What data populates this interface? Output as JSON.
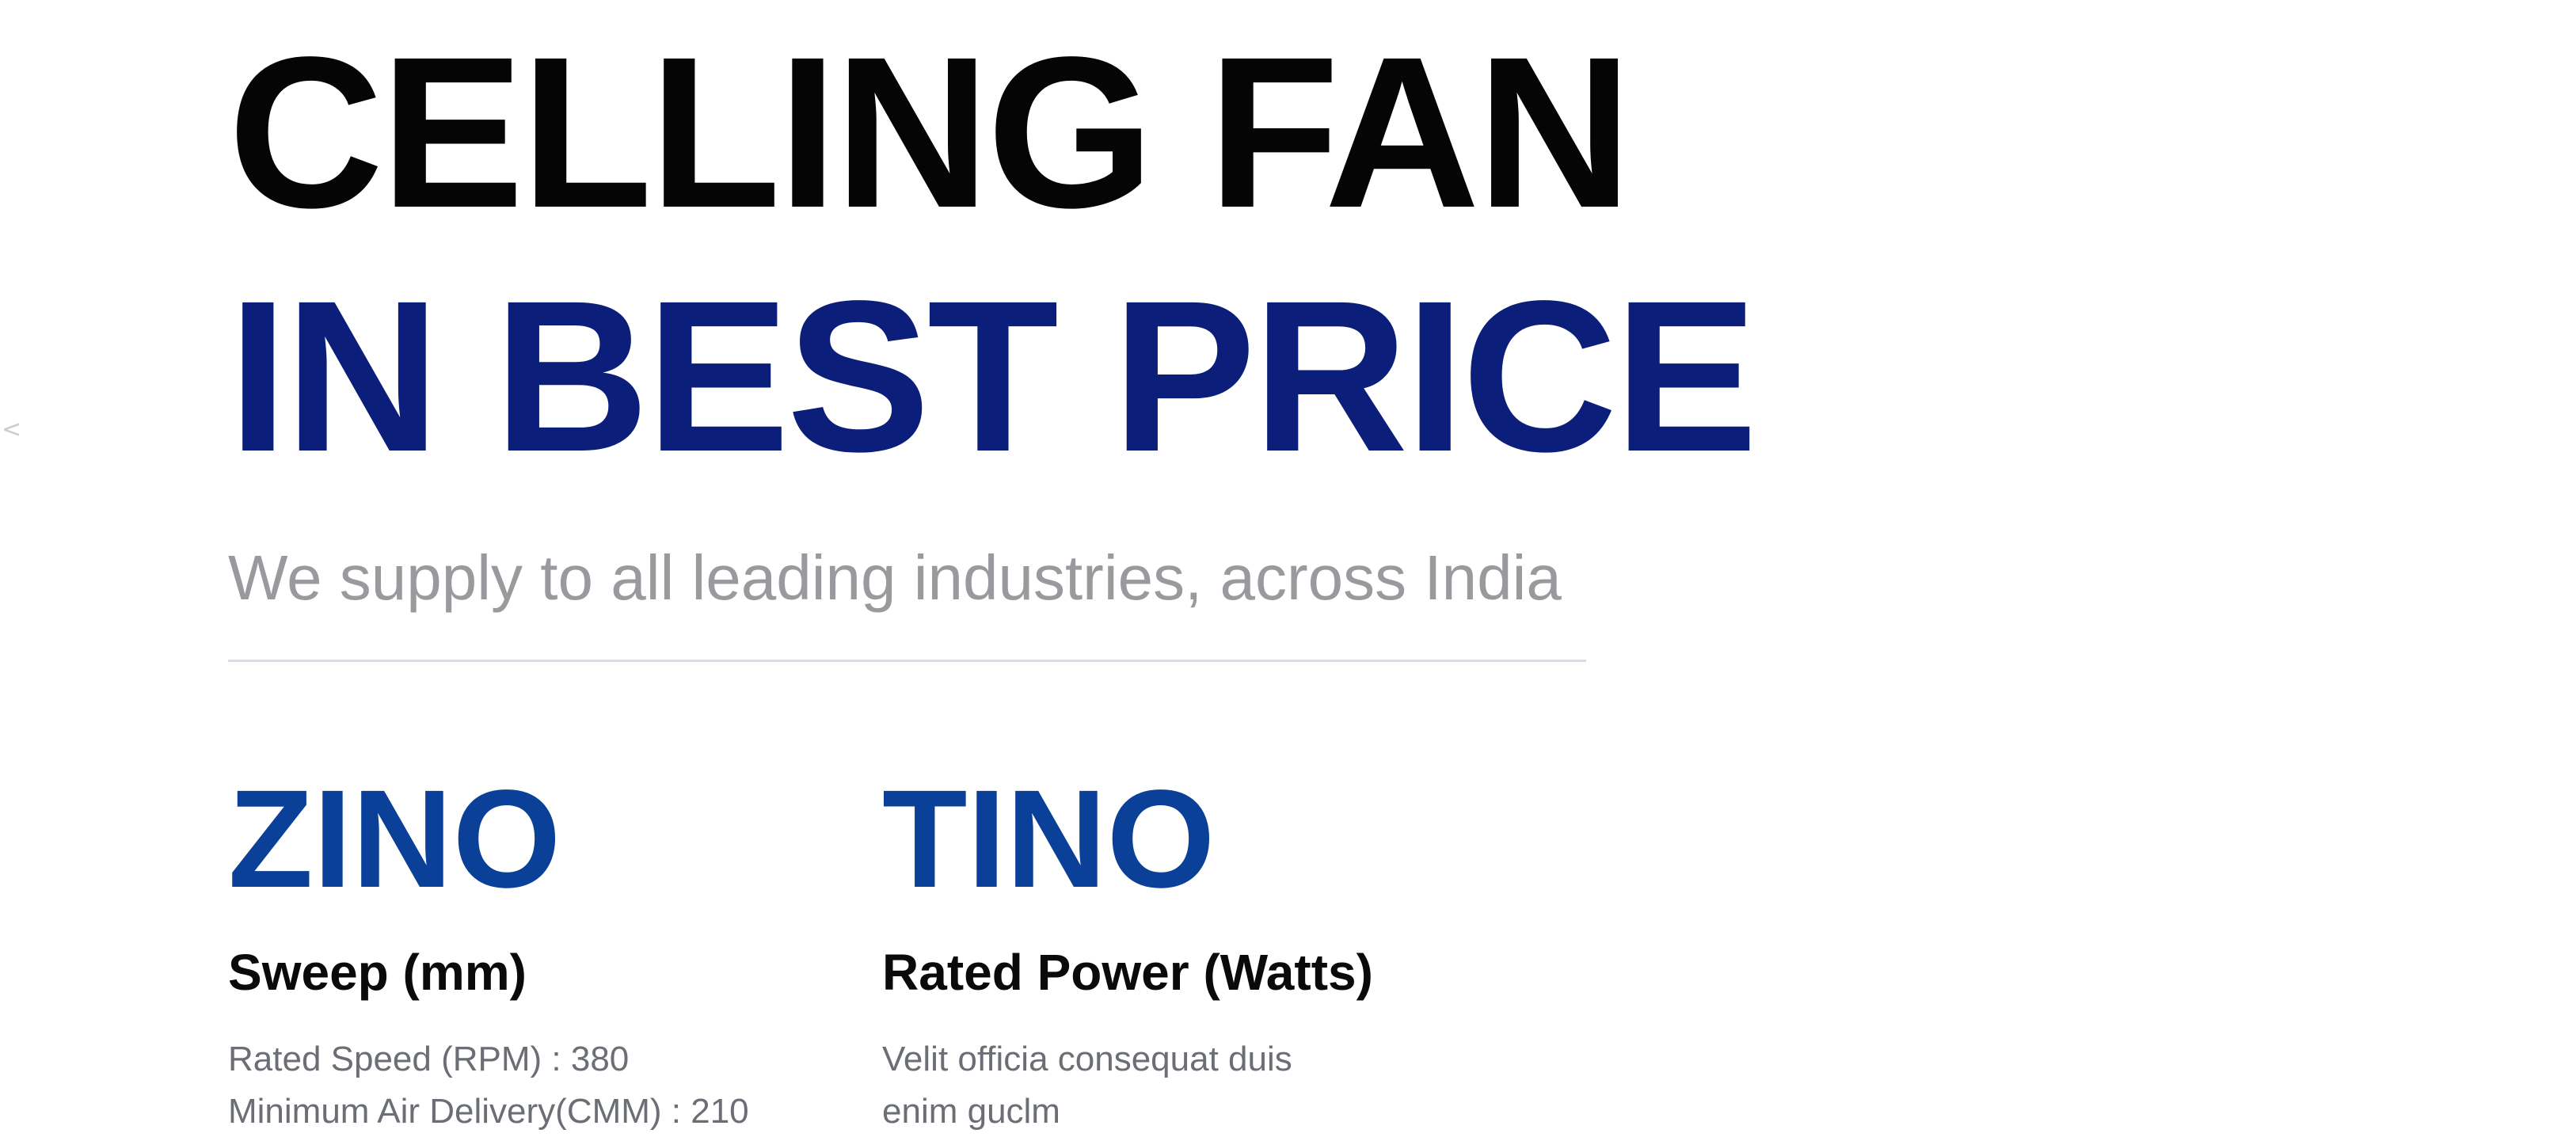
{
  "nav": {
    "prev_arrow": "<"
  },
  "hero": {
    "line1": "CELLING FAN",
    "line2": "IN BEST PRICE",
    "subtitle": "We supply to all leading industries, across India"
  },
  "products": [
    {
      "name": "ZINO",
      "heading": "Sweep (mm)",
      "lines": [
        "Rated Speed (RPM) : 380",
        "Minimum Air Delivery(CMM) : 210"
      ]
    },
    {
      "name": "TINO",
      "heading": "Rated Power (Watts)",
      "lines": [
        "Velit officia consequat duis",
        "enim guclm"
      ]
    }
  ],
  "colors": {
    "headline_dark": "#050505",
    "headline_blue": "#0b1f7a",
    "product_blue": "#0b4098",
    "subtitle_gray": "#9a9a9e"
  }
}
